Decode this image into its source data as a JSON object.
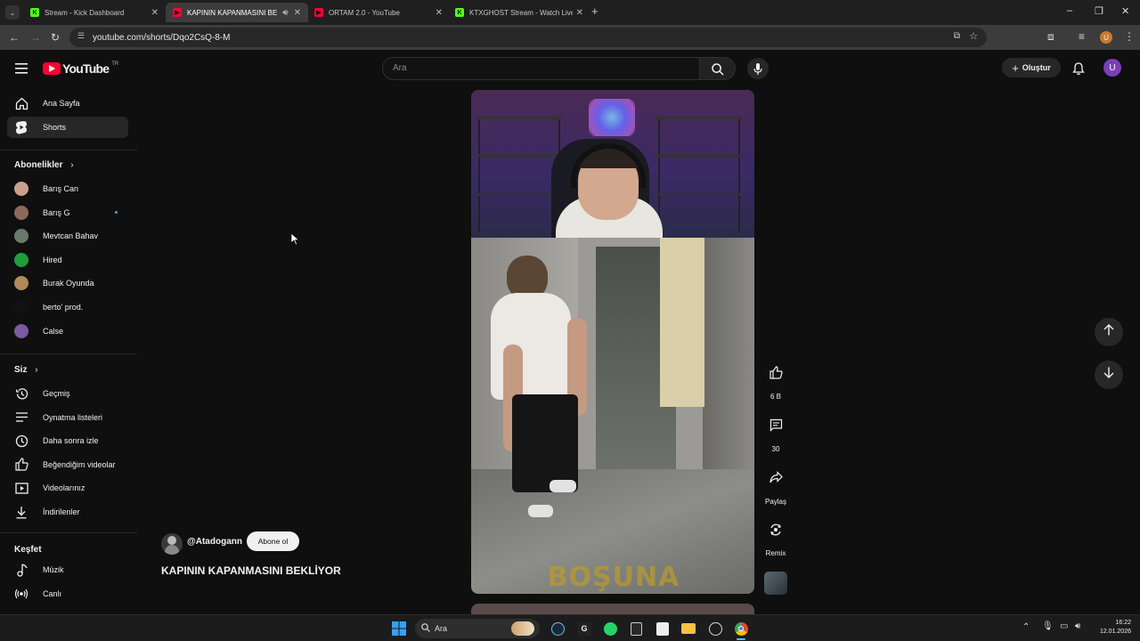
{
  "browser": {
    "tabs": [
      {
        "title": "Stream - Kick Dashboard",
        "color": "#53fc18",
        "glyph": "K",
        "active": false
      },
      {
        "title": "KAPININ KAPANMASINI BE",
        "color": "#ff0033",
        "glyph": "▶",
        "active": true
      },
      {
        "title": "ORTAM 2.0 - YouTube",
        "color": "#ff0033",
        "glyph": "▶",
        "active": false
      },
      {
        "title": "KTXGHOST Stream - Watch Live",
        "color": "#53fc18",
        "glyph": "K",
        "active": false
      }
    ],
    "url": "youtube.com/shorts/Dqo2CsQ-8-M",
    "profile_initial": "U"
  },
  "masthead": {
    "logo_text": "YouTube",
    "country_code": "TR",
    "search_placeholder": "Ara",
    "create_label": "Oluştur",
    "avatar_initial": "U"
  },
  "sidebar": {
    "main": [
      {
        "label": "Ana Sayfa",
        "icon": "home-icon"
      },
      {
        "label": "Shorts",
        "icon": "shorts-icon",
        "active": true
      }
    ],
    "subscriptions_heading": "Abonelikler",
    "subscriptions": [
      {
        "label": "Barış Can",
        "avatar_color": "#c9a08a"
      },
      {
        "label": "Barış G",
        "avatar_color": "#8a6a5a",
        "new_content": true
      },
      {
        "label": "Mevtcan Bahav",
        "avatar_color": "#6a7a6a"
      },
      {
        "label": "Hired",
        "avatar_color": "#1f9e3a"
      },
      {
        "label": "Burak Oyunda",
        "avatar_color": "#b08a5a"
      },
      {
        "label": "berto' prod.",
        "avatar_color": "#111111"
      },
      {
        "label": "Calse",
        "avatar_color": "#7a5aa0"
      }
    ],
    "you_heading": "Siz",
    "you": [
      {
        "label": "Geçmiş",
        "icon": "history-icon"
      },
      {
        "label": "Oynatma listeleri",
        "icon": "playlists-icon"
      },
      {
        "label": "Daha sonra izle",
        "icon": "watch-later-icon"
      },
      {
        "label": "Beğendiğim videolar",
        "icon": "liked-videos-icon"
      },
      {
        "label": "Videolarınız",
        "icon": "your-videos-icon"
      },
      {
        "label": "İndirilenler",
        "icon": "downloads-icon"
      }
    ],
    "explore_heading": "Keşfet",
    "explore": [
      {
        "label": "Müzik",
        "icon": "music-icon"
      },
      {
        "label": "Canlı",
        "icon": "live-icon"
      }
    ]
  },
  "short": {
    "channel": "@Atadogann",
    "subscribe_label": "Abone ol",
    "title": "KAPININ KAPANMASINI BEKLİYOR",
    "overlay_caption": "BOŞUNA",
    "likes": "6 B",
    "comments": "30",
    "share_label": "Paylaş",
    "remix_label": "Remix"
  },
  "taskbar": {
    "search_label": "Ara",
    "time": "16:22",
    "date": "12.01.2026"
  }
}
